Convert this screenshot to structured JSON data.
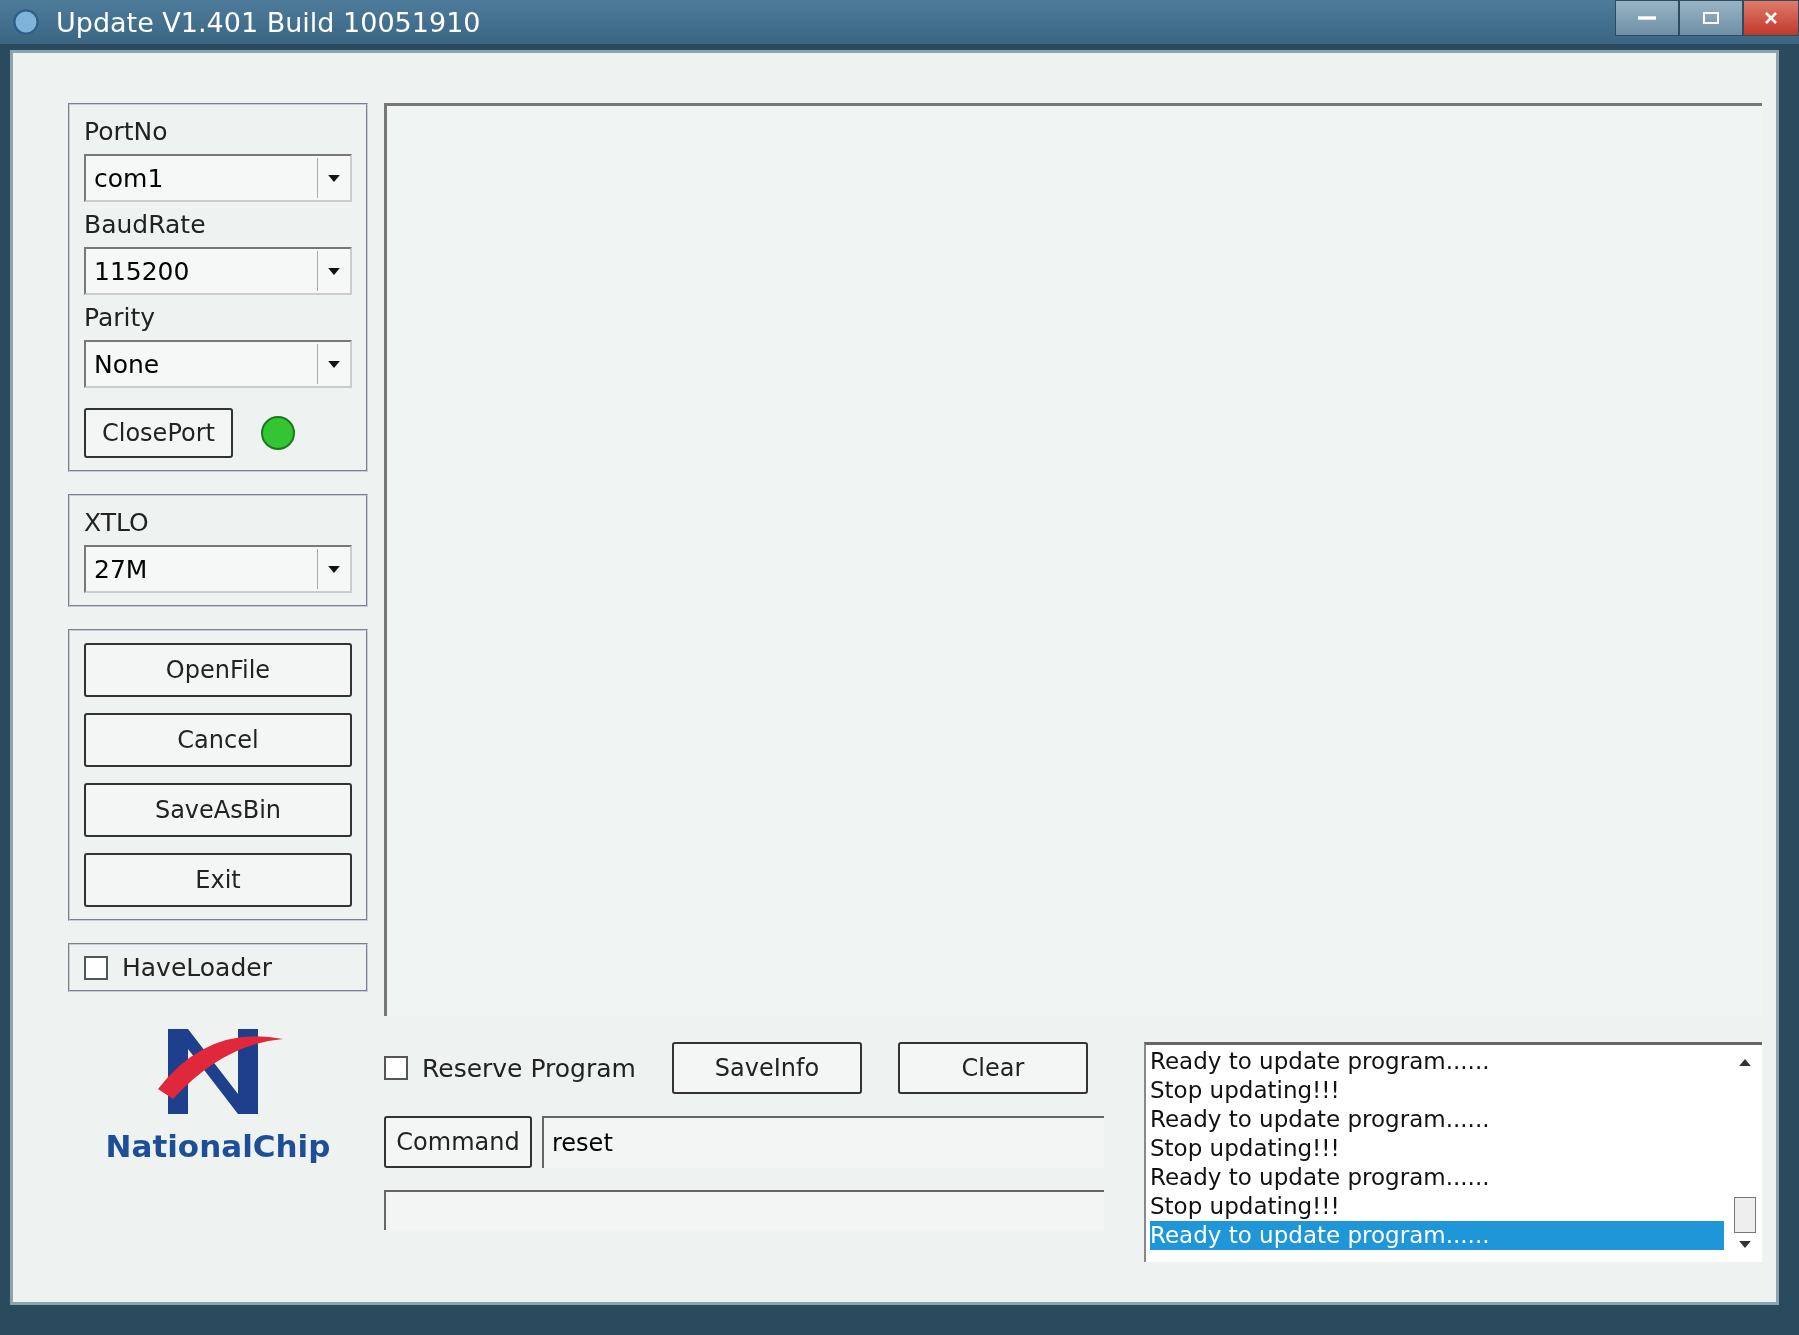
{
  "window": {
    "title": "Update V1.401 Build 10051910"
  },
  "port_group": {
    "fields": [
      {
        "label": "PortNo",
        "value": "com1"
      },
      {
        "label": "BaudRate",
        "value": "115200"
      },
      {
        "label": "Parity",
        "value": "None"
      }
    ],
    "button": "ClosePort",
    "port_open": true
  },
  "xtlo": {
    "label": "XTLO",
    "value": "27M"
  },
  "buttons": [
    "OpenFile",
    "Cancel",
    "SaveAsBin",
    "Exit"
  ],
  "have_loader": {
    "label": "HaveLoader",
    "checked": false
  },
  "logo": {
    "text": "NationalChip"
  },
  "reserve_program": {
    "label": "Reserve Program",
    "checked": false
  },
  "save_info": "SaveInfo",
  "clear": "Clear",
  "command": {
    "button": "Command",
    "value": "reset"
  },
  "log": [
    {
      "text": "Ready to update program......",
      "selected": false
    },
    {
      "text": "Stop updating!!!",
      "selected": false
    },
    {
      "text": "Ready to update program......",
      "selected": false
    },
    {
      "text": "Stop updating!!!",
      "selected": false
    },
    {
      "text": "Ready to update program......",
      "selected": false
    },
    {
      "text": "Stop updating!!!",
      "selected": false
    },
    {
      "text": "Ready to update program......",
      "selected": true
    }
  ]
}
